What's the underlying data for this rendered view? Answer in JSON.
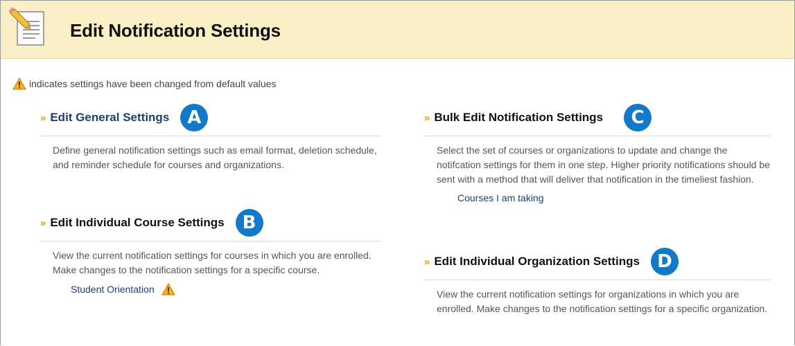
{
  "header": {
    "title": "Edit Notification Settings"
  },
  "legend": {
    "text": "indicates settings have been changed from default values"
  },
  "sections": [
    {
      "title": "Edit General Settings",
      "badge": "A",
      "description": "Define general notification settings such as email format, deletion schedule, and reminder schedule for courses and organizations."
    },
    {
      "title": "Edit Individual Course Settings",
      "badge": "B",
      "description": "View the current notification settings for courses in which you are enrolled. Make changes to the notification settings for a specific course.",
      "link": "Student Orientation"
    },
    {
      "title": "Bulk Edit Notification Settings",
      "badge": "C",
      "description": "Select the set of courses or organizations to update and change the notifcation settings for them in one step. Higher priority notifications should be sent with a method that will deliver that notification in the timeliest fashion.",
      "link": "Courses I am taking"
    },
    {
      "title": "Edit Individual Organization Settings",
      "badge": "D",
      "description": "View the current notification settings for organizations in which you are enrolled. Make changes to the notification settings for a specific organization."
    }
  ],
  "icons": {
    "page": "document-pencil-icon",
    "warning": "warning-triangle-icon"
  },
  "colors": {
    "header_bg": "#fbefc5",
    "link": "#1f3e6e",
    "badge": "#1278c8",
    "raquo": "#e0a300"
  }
}
